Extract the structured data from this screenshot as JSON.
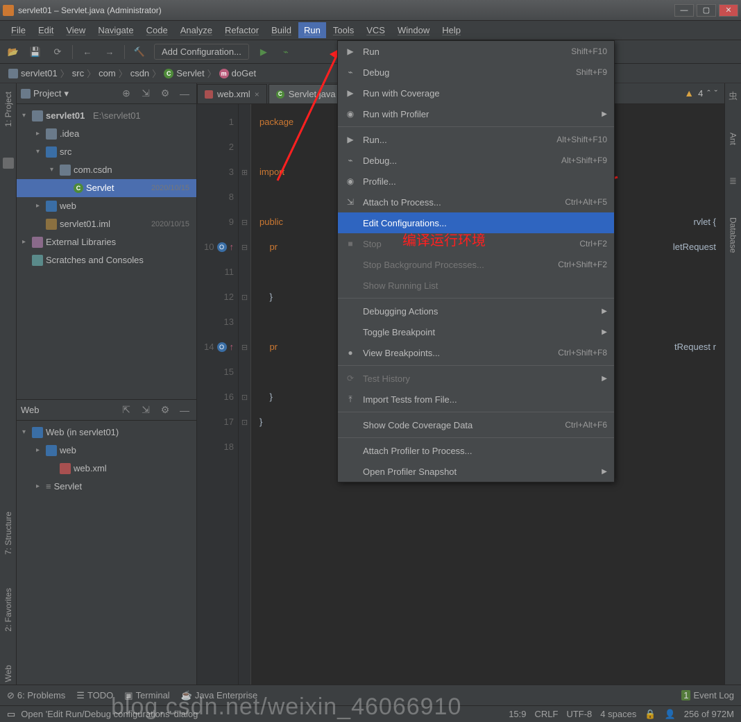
{
  "titlebar": {
    "title": "servlet01 – Servlet.java (Administrator)"
  },
  "menubar": [
    "File",
    "Edit",
    "View",
    "Navigate",
    "Code",
    "Analyze",
    "Refactor",
    "Build",
    "Run",
    "Tools",
    "VCS",
    "Window",
    "Help"
  ],
  "toolbar": {
    "add_configuration": "Add Configuration..."
  },
  "breadcrumb": [
    "servlet01",
    "src",
    "com",
    "csdn",
    "Servlet",
    "doGet"
  ],
  "project_panel": {
    "title": "Project",
    "root": {
      "name": "servlet01",
      "path": "E:\\servlet01"
    },
    "items": [
      {
        "name": ".idea",
        "indent": 1
      },
      {
        "name": "src",
        "indent": 1,
        "expanded": true
      },
      {
        "name": "com.csdn",
        "indent": 2,
        "expanded": true
      },
      {
        "name": "Servlet",
        "indent": 3,
        "selected": true,
        "date": "2020/10/15"
      },
      {
        "name": "web",
        "indent": 1
      },
      {
        "name": "servlet01.iml",
        "indent": 1,
        "date": "2020/10/15"
      }
    ],
    "external": "External Libraries",
    "scratches": "Scratches and Consoles"
  },
  "web_panel": {
    "title": "Web",
    "root": "Web (in servlet01)",
    "items": [
      {
        "name": "web",
        "indent": 1
      },
      {
        "name": "web.xml",
        "indent": 2
      },
      {
        "name": "Servlet",
        "indent": 1
      }
    ]
  },
  "tabs": [
    {
      "name": "web.xml",
      "active": false
    },
    {
      "name": "Servlet.java",
      "active": true
    }
  ],
  "warnings": {
    "count": "4"
  },
  "code": {
    "lines": [
      "1",
      "2",
      "3",
      "8",
      "9",
      "10",
      "11",
      "12",
      "13",
      "14",
      "15",
      "16",
      "17",
      "18"
    ],
    "text": {
      "l1": "package",
      "l3": "import",
      "l9": "public",
      "l10": "pr",
      "l12": "}",
      "l14": "pr",
      "l16": "}",
      "l17": "}",
      "r9": "rvlet {",
      "r10": "letRequest",
      "r14": "tRequest r"
    }
  },
  "run_menu": [
    {
      "label": "Run",
      "shortcut": "Shift+F10",
      "icon": "▶"
    },
    {
      "label": "Debug",
      "shortcut": "Shift+F9",
      "icon": "⌁"
    },
    {
      "label": "Run with Coverage",
      "icon": "▶"
    },
    {
      "label": "Run with Profiler",
      "arrow": true,
      "icon": "◉"
    },
    {
      "sep": true
    },
    {
      "label": "Run...",
      "shortcut": "Alt+Shift+F10",
      "icon": "▶"
    },
    {
      "label": "Debug...",
      "shortcut": "Alt+Shift+F9",
      "icon": "⌁"
    },
    {
      "label": "Profile...",
      "icon": "◉"
    },
    {
      "label": "Attach to Process...",
      "shortcut": "Ctrl+Alt+F5",
      "icon": "⇲"
    },
    {
      "label": "Edit Configurations...",
      "highlight": true
    },
    {
      "label": "Stop",
      "shortcut": "Ctrl+F2",
      "icon": "■",
      "disabled": true
    },
    {
      "label": "Stop Background Processes...",
      "shortcut": "Ctrl+Shift+F2",
      "disabled": true
    },
    {
      "label": "Show Running List",
      "disabled": true
    },
    {
      "sep": true
    },
    {
      "label": "Debugging Actions",
      "arrow": true
    },
    {
      "label": "Toggle Breakpoint",
      "arrow": true
    },
    {
      "label": "View Breakpoints...",
      "shortcut": "Ctrl+Shift+F8",
      "icon": "●"
    },
    {
      "sep": true
    },
    {
      "label": "Test History",
      "arrow": true,
      "icon": "⟳",
      "disabled": true
    },
    {
      "label": "Import Tests from File...",
      "icon": "⤒"
    },
    {
      "sep": true
    },
    {
      "label": "Show Code Coverage Data",
      "shortcut": "Ctrl+Alt+F6"
    },
    {
      "sep": true
    },
    {
      "label": "Attach Profiler to Process..."
    },
    {
      "label": "Open Profiler Snapshot",
      "arrow": true
    }
  ],
  "leftbar": {
    "project": "1: Project",
    "structure": "7: Structure",
    "favorites": "2: Favorites",
    "web": "Web"
  },
  "rightbar": {
    "ant": "Ant",
    "database": "Database"
  },
  "bottombar": {
    "problems": "6: Problems",
    "todo": "TODO",
    "terminal": "Terminal",
    "je": "Java Enterprise",
    "eventlog": "Event Log"
  },
  "statusbar": {
    "hint": "Open 'Edit Run/Debug configurations' dialog",
    "pos": "15:9",
    "eol": "CRLF",
    "enc": "UTF-8",
    "indent": "4 spaces",
    "mem": "256 of 972M"
  },
  "annotation": {
    "text": "编译运行环境"
  },
  "watermark": "blog.csdn.net/weixin_46066910"
}
